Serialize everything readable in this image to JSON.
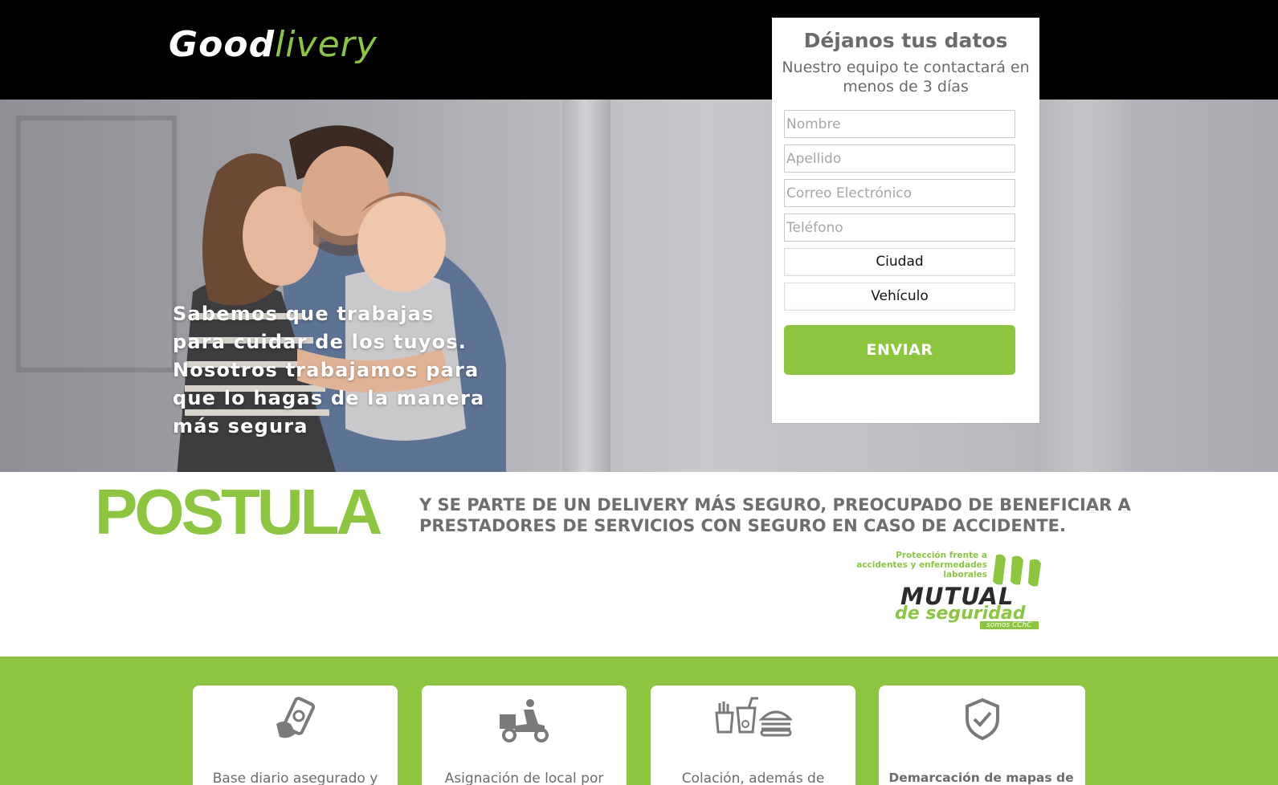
{
  "brand": {
    "logo_part1": "Good",
    "logo_part2": "livery"
  },
  "hero": {
    "headline": "Sabemos que trabajas para cuidar de los tuyos. Nosotros trabajamos para que lo hagas de la manera más segura"
  },
  "form": {
    "title": "Déjanos tus datos",
    "subtitle": "Nuestro equipo te contactará en menos de 3 días",
    "nombre_placeholder": "Nombre",
    "apellido_placeholder": "Apellido",
    "correo_placeholder": "Correo Electrónico",
    "telefono_placeholder": "Teléfono",
    "ciudad_selected": "Ciudad",
    "vehiculo_selected": "Vehículo",
    "submit_label": "ENVIAR"
  },
  "postula": {
    "heading": "POSTULA",
    "description": "Y SE PARTE DE UN DELIVERY MÁS SEGURO, PREOCUPADO DE BENEFICIAR A PRESTADORES DE SERVICIOS CON SEGURO EN CASO DE ACCIDENTE."
  },
  "mutual": {
    "tagline": "Protección frente a accidentes y enfermedades laborales",
    "name": "MUTUAL",
    "subname": "de seguridad",
    "badge": "somos CChC"
  },
  "features": [
    {
      "icon": "phone-payment-icon",
      "text": "Base diario asegurado y"
    },
    {
      "icon": "delivery-scooter-icon",
      "text": "Asignación de local por"
    },
    {
      "icon": "meal-icon",
      "text": "Colación, además de"
    },
    {
      "icon": "shield-check-icon",
      "text": "Demarcación de mapas de"
    }
  ],
  "colors": {
    "accent": "#8cc63f",
    "header_bg": "#000000",
    "text_gray": "#6b6b6b"
  }
}
